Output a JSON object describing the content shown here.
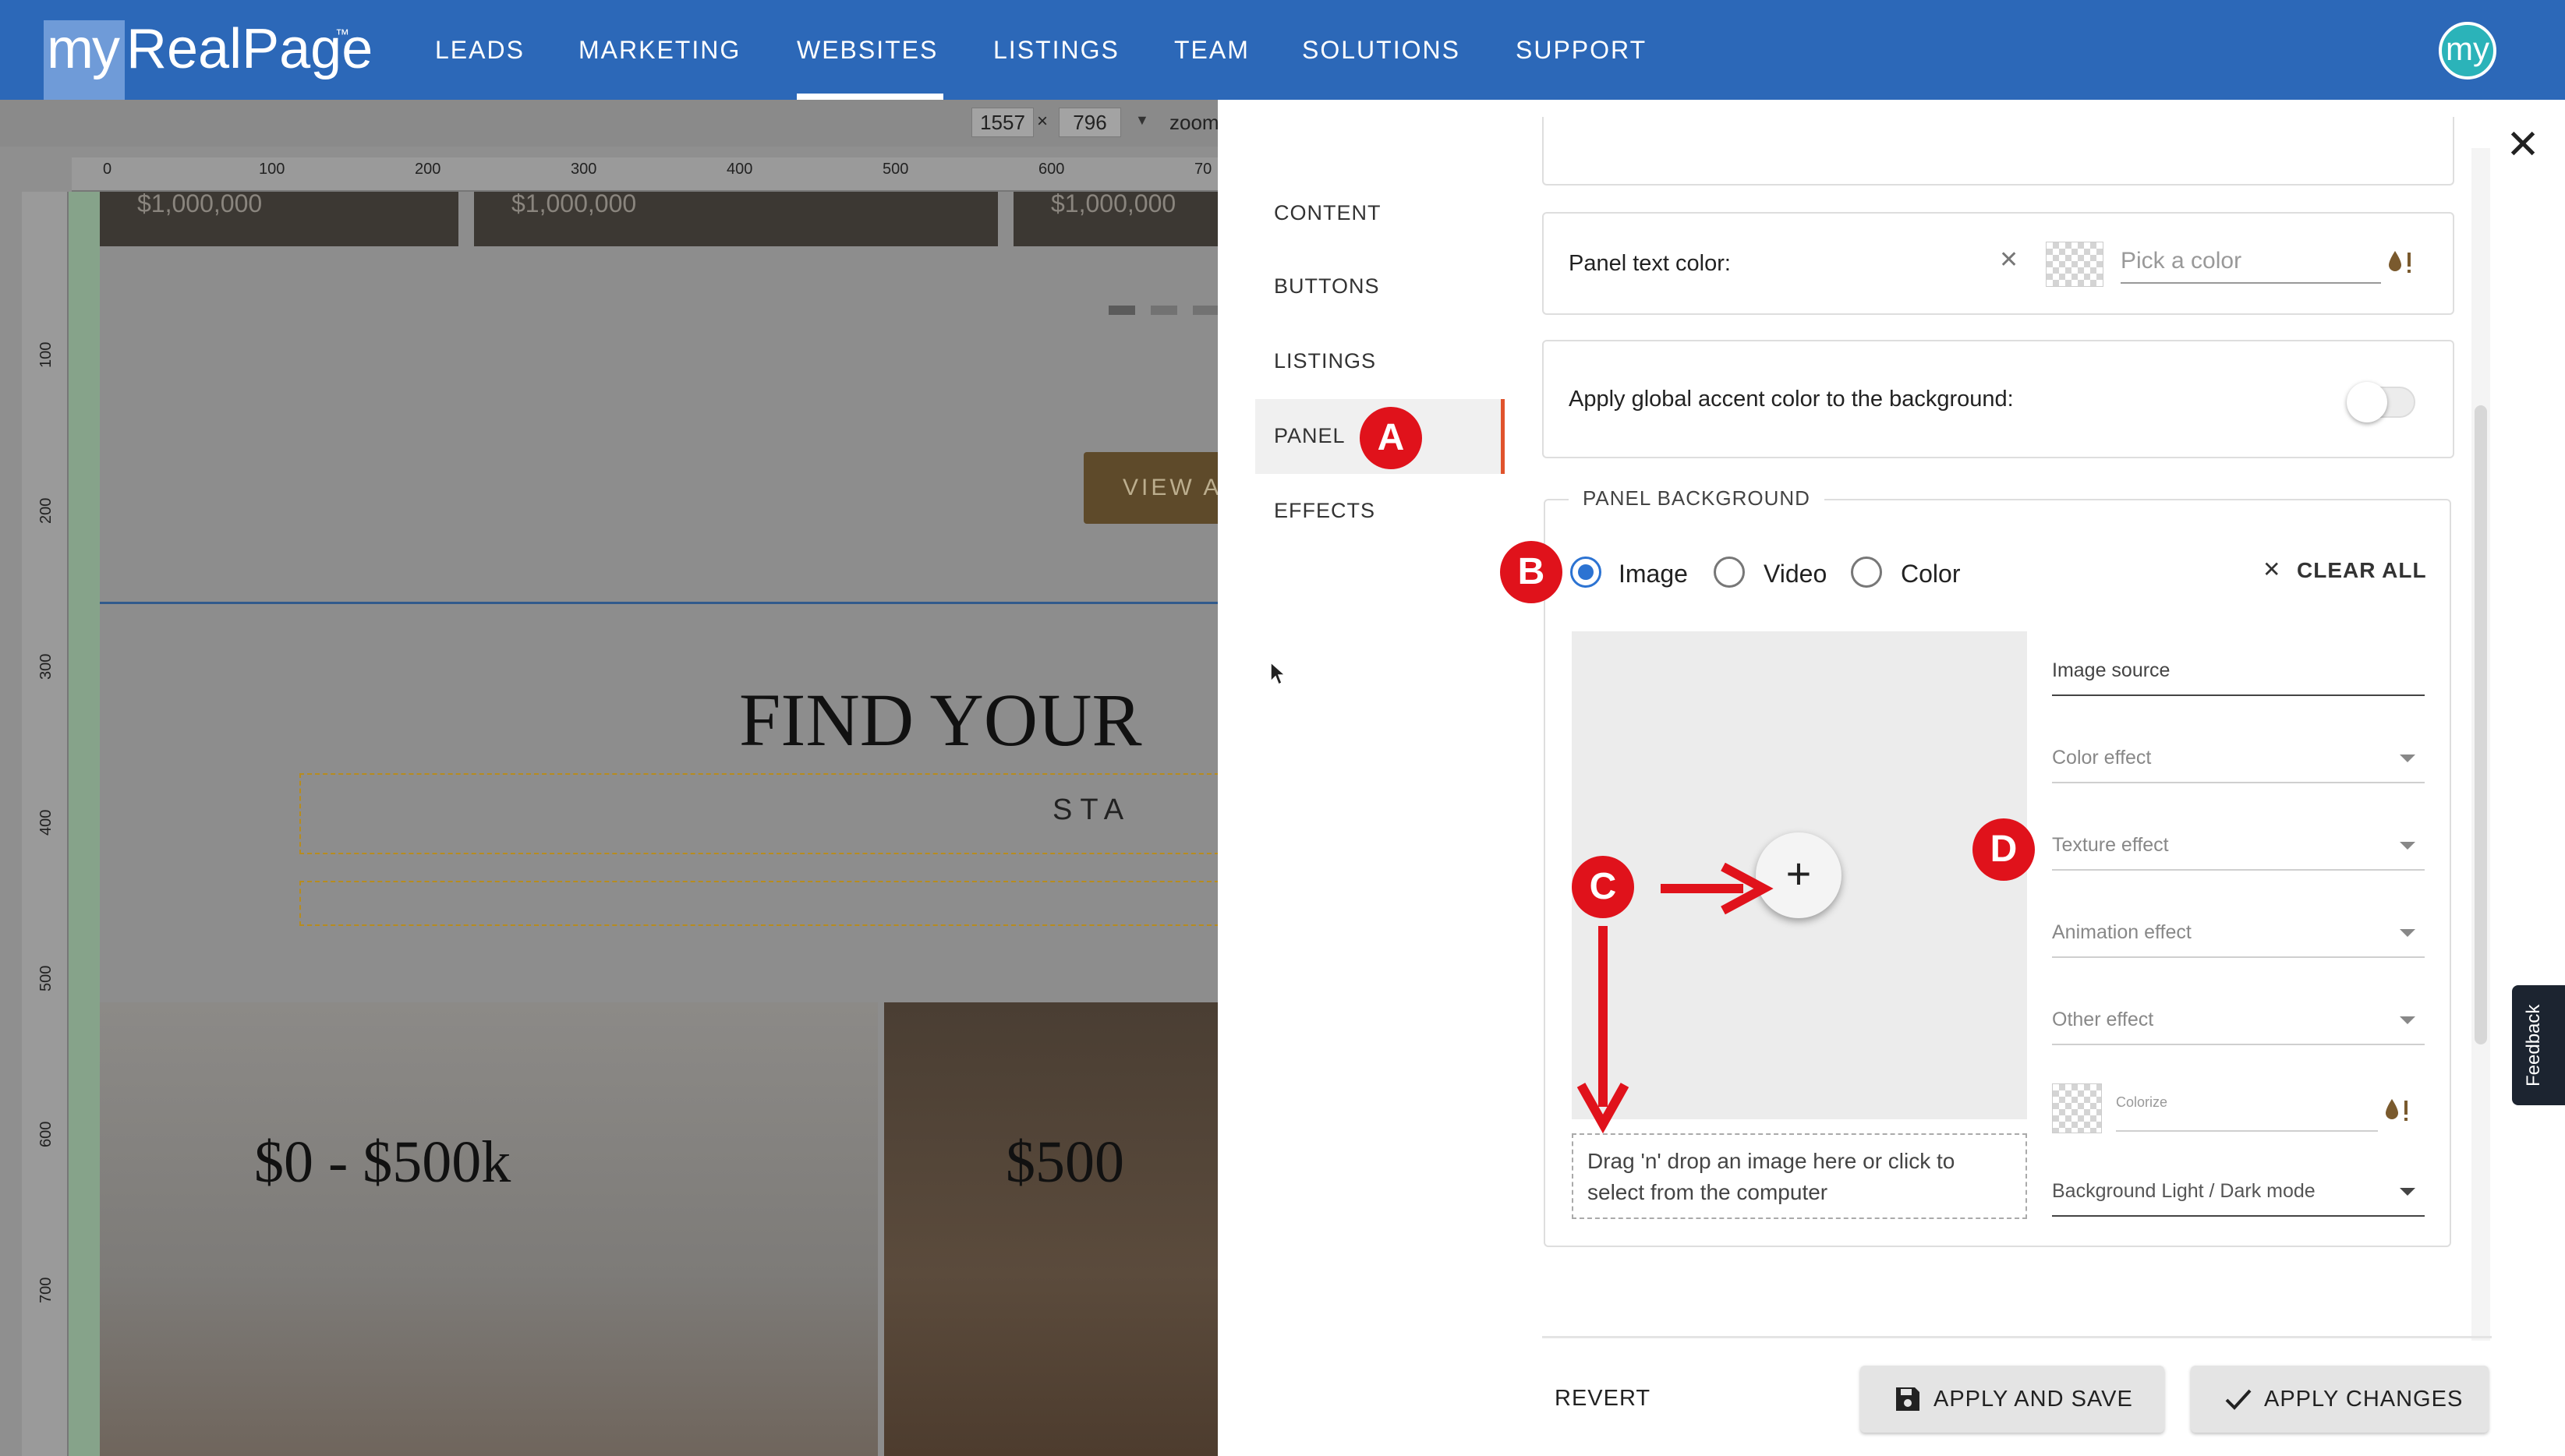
{
  "app": {
    "logo_prefix": "my",
    "logo_name": "RealPage",
    "logo_tm": "™",
    "avatar": "my"
  },
  "nav": {
    "items": [
      "LEADS",
      "MARKETING",
      "WEBSITES",
      "LISTINGS",
      "TEAM",
      "SOLUTIONS",
      "SUPPORT"
    ],
    "active": "WEBSITES"
  },
  "editor": {
    "width": "1557",
    "height": "796",
    "size_separator": "×",
    "zoom_label": "zoom",
    "ruler_top": [
      "0",
      "100",
      "200",
      "300",
      "400",
      "500",
      "600",
      "70"
    ],
    "ruler_left": [
      "100",
      "200",
      "300",
      "400",
      "500",
      "600",
      "700"
    ],
    "tile_price": "$1,000,000",
    "view_button": "VIEW A",
    "headline": "FIND YOUR",
    "subheadline": "STA",
    "price_left": "$0 - $500k",
    "price_right": "$500"
  },
  "panel": {
    "close_icon": "close-icon",
    "tabs": [
      "CONTENT",
      "BUTTONS",
      "LISTINGS",
      "PANEL",
      "EFFECTS"
    ],
    "active_tab": "PANEL",
    "panel_text_color_label": "Panel text color:",
    "pick_color_placeholder": "Pick a color",
    "accent_toggle_label": "Apply global accent color to the background:",
    "accent_toggle_on": false,
    "background_legend": "PANEL BACKGROUND",
    "bg_options": [
      "Image",
      "Video",
      "Color"
    ],
    "bg_selected": "Image",
    "clear_all": "CLEAR ALL",
    "upload_plus": "+",
    "drop_text": "Drag 'n' drop an image here or click to select from the computer",
    "fields": {
      "image_source": "Image source",
      "color_effect": "Color effect",
      "texture_effect": "Texture effect",
      "animation_effect": "Animation effect",
      "other_effect": "Other effect",
      "colorize": "Colorize",
      "light_dark_mode": "Background Light / Dark mode"
    },
    "feedback": "Feedback",
    "footer": {
      "revert": "REVERT",
      "apply_and_save": "APPLY AND SAVE",
      "apply_changes": "APPLY CHANGES"
    }
  },
  "annotations": {
    "labels": [
      "A",
      "B",
      "C",
      "D"
    ],
    "color": "#e0121b"
  },
  "colors": {
    "nav_blue": "#2c68b8",
    "active_tab_accent": "#e0532c",
    "radio_blue": "#2c73d2",
    "drop_icon": "#7a5a2e"
  }
}
